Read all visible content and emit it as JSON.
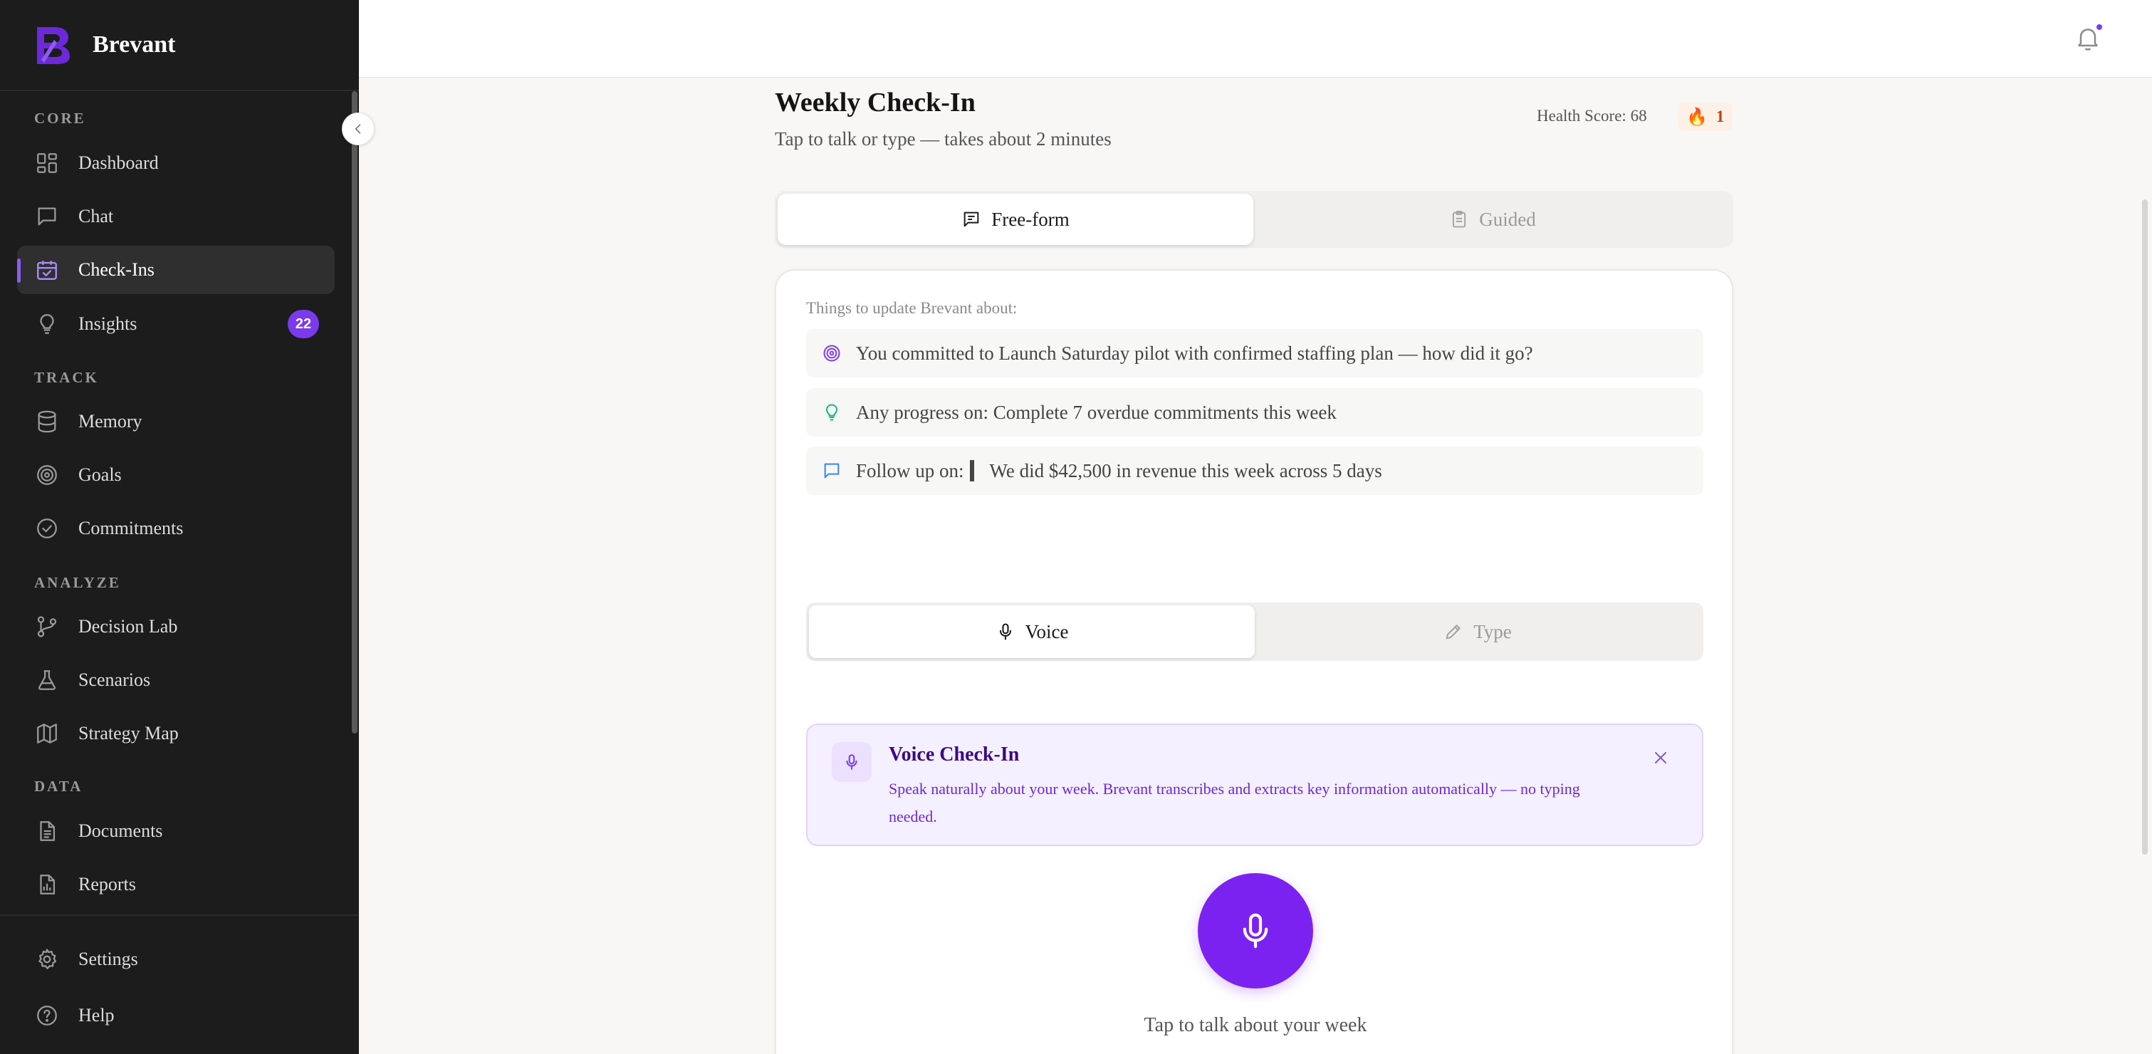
{
  "brand": {
    "name": "Brevant"
  },
  "sidebar": {
    "sections": {
      "core": "CORE",
      "track": "TRACK",
      "analyze": "ANALYZE",
      "data": "DATA"
    },
    "items": [
      {
        "label": "Dashboard",
        "icon": "dashboard-icon"
      },
      {
        "label": "Chat",
        "icon": "chat-icon"
      },
      {
        "label": "Check-Ins",
        "icon": "calendar-check-icon",
        "active": true
      },
      {
        "label": "Insights",
        "icon": "lightbulb-icon",
        "badge": "22"
      },
      {
        "label": "Memory",
        "icon": "database-icon"
      },
      {
        "label": "Goals",
        "icon": "target-icon"
      },
      {
        "label": "Commitments",
        "icon": "check-circle-icon"
      },
      {
        "label": "Decision Lab",
        "icon": "git-branch-icon"
      },
      {
        "label": "Scenarios",
        "icon": "flask-icon"
      },
      {
        "label": "Strategy Map",
        "icon": "map-icon"
      },
      {
        "label": "Documents",
        "icon": "document-icon"
      },
      {
        "label": "Reports",
        "icon": "report-icon"
      }
    ],
    "footer": [
      {
        "label": "Settings",
        "icon": "gear-icon"
      },
      {
        "label": "Help",
        "icon": "help-icon"
      }
    ]
  },
  "header": {
    "title": "Weekly Check-In",
    "subtitle": "Tap to talk or type — takes about 2 minutes",
    "health_score": "Health Score: 68",
    "streak": "1"
  },
  "mode_tabs": {
    "freeform": "Free-form",
    "guided": "Guided"
  },
  "card": {
    "hint": "Things to update Brevant about:",
    "prompts": [
      {
        "text": "You committed to Launch Saturday pilot with confirmed staffing plan — how did it go?",
        "icon": "target-icon"
      },
      {
        "text": "Any progress on: Complete 7 overdue commitments this week",
        "icon": "lightbulb-icon"
      },
      {
        "prefix": "Follow up on:",
        "text": "We did $42,500 in revenue this week across 5 days",
        "icon": "chat-icon"
      }
    ],
    "input_tabs": {
      "voice": "Voice",
      "type": "Type"
    },
    "voice_banner": {
      "title": "Voice Check-In",
      "body": "Speak naturally about your week. Brevant transcribes and extracts key information automatically — no typing needed."
    },
    "mic_caption": "Tap to talk about your week"
  },
  "colors": {
    "accent": "#7c22f0",
    "sidebar_bg": "#1c1c1c",
    "badge": "#7c3aed"
  }
}
